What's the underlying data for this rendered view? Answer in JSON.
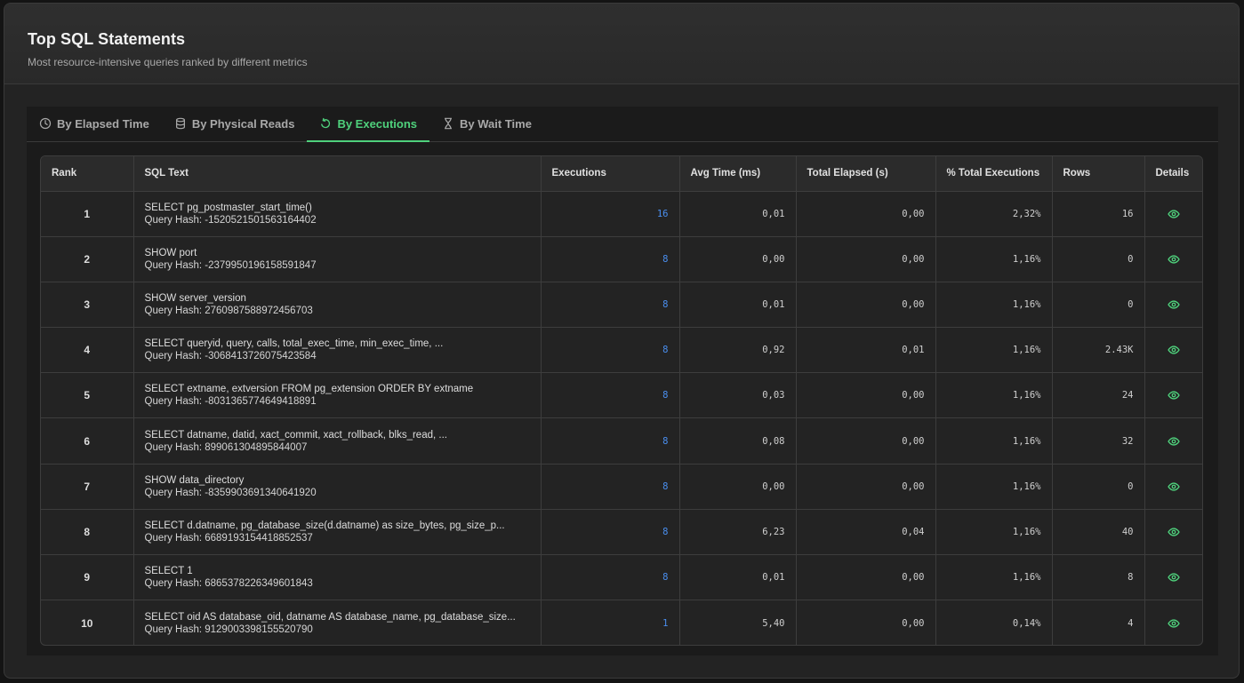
{
  "header": {
    "title": "Top SQL Statements",
    "subtitle": "Most resource-intensive queries ranked by different metrics"
  },
  "tabs": [
    {
      "label": "By Elapsed Time",
      "icon": "clock-icon",
      "active": false
    },
    {
      "label": "By Physical Reads",
      "icon": "database-icon",
      "active": false
    },
    {
      "label": "By Executions",
      "icon": "refresh-icon",
      "active": true
    },
    {
      "label": "By Wait Time",
      "icon": "hourglass-icon",
      "active": false
    }
  ],
  "colors": {
    "accent": "#4fd17c",
    "link": "#4a8ff0"
  },
  "table": {
    "columns": [
      "Rank",
      "SQL Text",
      "Executions",
      "Avg Time (ms)",
      "Total Elapsed (s)",
      "% Total Executions",
      "Rows",
      "Details"
    ],
    "rows": [
      {
        "rank": "1",
        "sql": "SELECT pg_postmaster_start_time()",
        "hash": "Query Hash: -1520521501563164402",
        "executions": "16",
        "avg": "0,01",
        "total": "0,00",
        "pct": "2,32%",
        "rows": "16"
      },
      {
        "rank": "2",
        "sql": "SHOW port",
        "hash": "Query Hash: -2379950196158591847",
        "executions": "8",
        "avg": "0,00",
        "total": "0,00",
        "pct": "1,16%",
        "rows": "0"
      },
      {
        "rank": "3",
        "sql": "SHOW server_version",
        "hash": "Query Hash: 2760987588972456703",
        "executions": "8",
        "avg": "0,01",
        "total": "0,00",
        "pct": "1,16%",
        "rows": "0"
      },
      {
        "rank": "4",
        "sql": "SELECT queryid, query, calls, total_exec_time, min_exec_time, ...",
        "hash": "Query Hash: -3068413726075423584",
        "executions": "8",
        "avg": "0,92",
        "total": "0,01",
        "pct": "1,16%",
        "rows": "2.43K"
      },
      {
        "rank": "5",
        "sql": "SELECT extname, extversion FROM pg_extension ORDER BY extname",
        "hash": "Query Hash: -8031365774649418891",
        "executions": "8",
        "avg": "0,03",
        "total": "0,00",
        "pct": "1,16%",
        "rows": "24"
      },
      {
        "rank": "6",
        "sql": "SELECT datname, datid, xact_commit, xact_rollback, blks_read, ...",
        "hash": "Query Hash: 899061304895844007",
        "executions": "8",
        "avg": "0,08",
        "total": "0,00",
        "pct": "1,16%",
        "rows": "32"
      },
      {
        "rank": "7",
        "sql": "SHOW data_directory",
        "hash": "Query Hash: -8359903691340641920",
        "executions": "8",
        "avg": "0,00",
        "total": "0,00",
        "pct": "1,16%",
        "rows": "0"
      },
      {
        "rank": "8",
        "sql": "SELECT d.datname, pg_database_size(d.datname) as size_bytes, pg_size_p...",
        "hash": "Query Hash: 6689193154418852537",
        "executions": "8",
        "avg": "6,23",
        "total": "0,04",
        "pct": "1,16%",
        "rows": "40"
      },
      {
        "rank": "9",
        "sql": "SELECT 1",
        "hash": "Query Hash: 6865378226349601843",
        "executions": "8",
        "avg": "0,01",
        "total": "0,00",
        "pct": "1,16%",
        "rows": "8"
      },
      {
        "rank": "10",
        "sql": "SELECT oid AS database_oid, datname AS database_name, pg_database_size...",
        "hash": "Query Hash: 9129003398155520790",
        "executions": "1",
        "avg": "5,40",
        "total": "0,00",
        "pct": "0,14%",
        "rows": "4"
      }
    ]
  }
}
